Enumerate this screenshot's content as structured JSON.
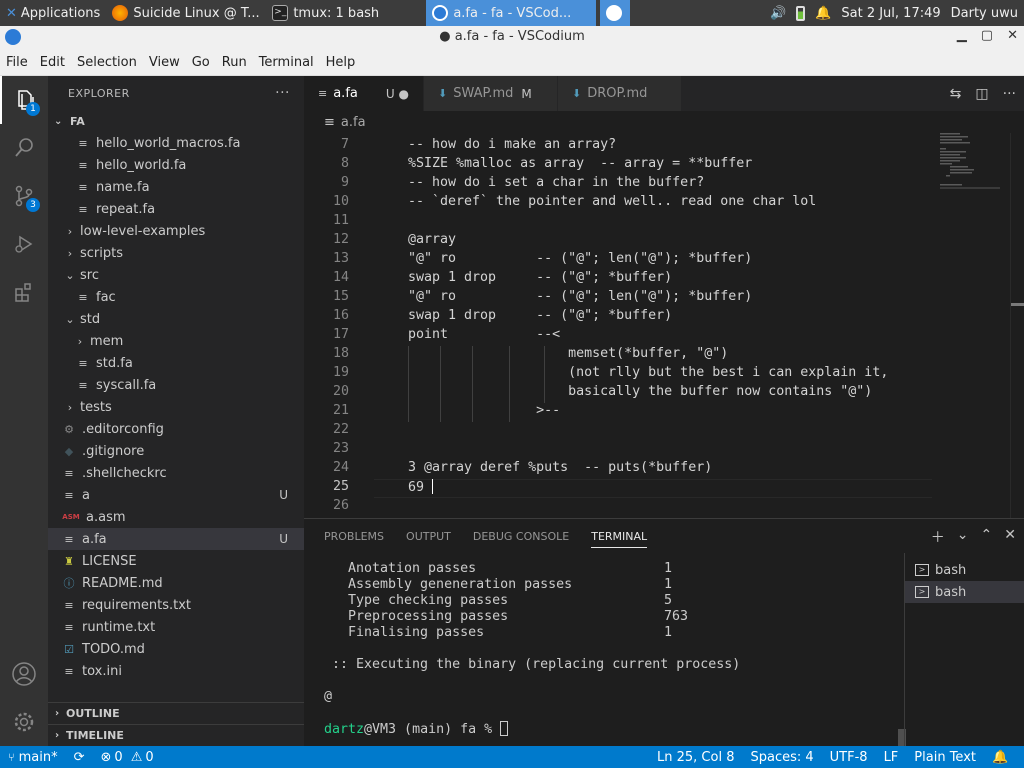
{
  "taskbar": {
    "apps_label": "Applications",
    "tasks": [
      "Suicide Linux @ T...",
      "tmux: 1 bash",
      "a.fa - fa - VSCod..."
    ],
    "clock": "Sat  2 Jul, 17:49",
    "user": "Darty uwu"
  },
  "window": {
    "title": "● a.fa - fa - VSCodium"
  },
  "menu": [
    "File",
    "Edit",
    "Selection",
    "View",
    "Go",
    "Run",
    "Terminal",
    "Help"
  ],
  "activity": {
    "explorer_badge": "1",
    "scm_badge": "3"
  },
  "explorer": {
    "header": "EXPLORER",
    "more": "···",
    "root": "FA",
    "items": [
      {
        "label": "hello_world_macros.fa",
        "marker": ""
      },
      {
        "label": "hello_world.fa",
        "marker": ""
      },
      {
        "label": "name.fa",
        "marker": ""
      },
      {
        "label": "repeat.fa",
        "marker": ""
      },
      {
        "label": "low-level-examples",
        "marker": ""
      },
      {
        "label": "scripts",
        "marker": ""
      },
      {
        "label": "src",
        "marker": ""
      },
      {
        "label": "fac",
        "marker": ""
      },
      {
        "label": "std",
        "marker": ""
      },
      {
        "label": "mem",
        "marker": ""
      },
      {
        "label": "std.fa",
        "marker": ""
      },
      {
        "label": "syscall.fa",
        "marker": ""
      },
      {
        "label": "tests",
        "marker": ""
      },
      {
        "label": ".editorconfig",
        "marker": ""
      },
      {
        "label": ".gitignore",
        "marker": ""
      },
      {
        "label": ".shellcheckrc",
        "marker": ""
      },
      {
        "label": "a",
        "marker": "U"
      },
      {
        "label": "a.asm",
        "marker": ""
      },
      {
        "label": "a.fa",
        "marker": "U"
      },
      {
        "label": "LICENSE",
        "marker": ""
      },
      {
        "label": "README.md",
        "marker": ""
      },
      {
        "label": "requirements.txt",
        "marker": ""
      },
      {
        "label": "runtime.txt",
        "marker": ""
      },
      {
        "label": "TODO.md",
        "marker": ""
      },
      {
        "label": "tox.ini",
        "marker": ""
      }
    ],
    "outline": "OUTLINE",
    "timeline": "TIMELINE"
  },
  "tabs": [
    {
      "label": "a.fa",
      "mark": "U ●"
    },
    {
      "label": "SWAP.md",
      "mark": "M"
    },
    {
      "label": "DROP.md",
      "mark": ""
    }
  ],
  "breadcrumb": "a.fa",
  "editor": {
    "lines": [
      {
        "n": "7",
        "text": "-- how do i make an array?"
      },
      {
        "n": "8",
        "text": "%SIZE %malloc as array  -- array = **buffer"
      },
      {
        "n": "9",
        "text": "-- how do i set a char in the buffer?"
      },
      {
        "n": "10",
        "text": "-- `deref` the pointer and well.. read one char lol"
      },
      {
        "n": "11",
        "text": ""
      },
      {
        "n": "12",
        "text": "@array"
      },
      {
        "n": "13",
        "text": "\"@\" ro          -- (\"@\"; len(\"@\"); *buffer)"
      },
      {
        "n": "14",
        "text": "swap 1 drop     -- (\"@\"; *buffer)"
      },
      {
        "n": "15",
        "text": "\"@\" ro          -- (\"@\"; len(\"@\"); *buffer)"
      },
      {
        "n": "16",
        "text": "swap 1 drop     -- (\"@\"; *buffer)"
      },
      {
        "n": "17",
        "text": "point           --<"
      },
      {
        "n": "18",
        "text": "                    memset(*buffer, \"@\")"
      },
      {
        "n": "19",
        "text": "                    (not rlly but the best i can explain it,"
      },
      {
        "n": "20",
        "text": "                    basically the buffer now contains \"@\")"
      },
      {
        "n": "21",
        "text": "                >--"
      },
      {
        "n": "22",
        "text": ""
      },
      {
        "n": "23",
        "text": ""
      },
      {
        "n": "24",
        "text": "3 @array deref %puts  -- puts(*buffer)"
      },
      {
        "n": "25",
        "text": "69 "
      },
      {
        "n": "26",
        "text": ""
      }
    ],
    "current_line": "25"
  },
  "panel": {
    "tabs": [
      "PROBLEMS",
      "OUTPUT",
      "DEBUG CONSOLE",
      "TERMINAL"
    ],
    "active_tab": "TERMINAL",
    "terminal": {
      "stats": [
        {
          "label": "Anotation passes",
          "value": "1"
        },
        {
          "label": "Assembly geneneration passes",
          "value": "1"
        },
        {
          "label": "Type checking passes",
          "value": "5"
        },
        {
          "label": "Preprocessing passes",
          "value": "763"
        },
        {
          "label": "Finalising passes",
          "value": "1"
        }
      ],
      "exec_msg": ":: Executing the binary (replacing current process)",
      "output": "@",
      "prompt_user": "dartz",
      "prompt_rest": "@VM3 (main) fa % "
    },
    "terminal_list": [
      "bash",
      "bash"
    ]
  },
  "statusbar": {
    "branch": "main*",
    "errors": "0",
    "warnings": "0",
    "position": "Ln 25, Col 8",
    "spaces": "Spaces: 4",
    "encoding": "UTF-8",
    "eol": "LF",
    "language": "Plain Text"
  },
  "colors": {
    "accent": "#007acc",
    "terminal_user": "#23d18b",
    "badge": "#0078d4"
  }
}
